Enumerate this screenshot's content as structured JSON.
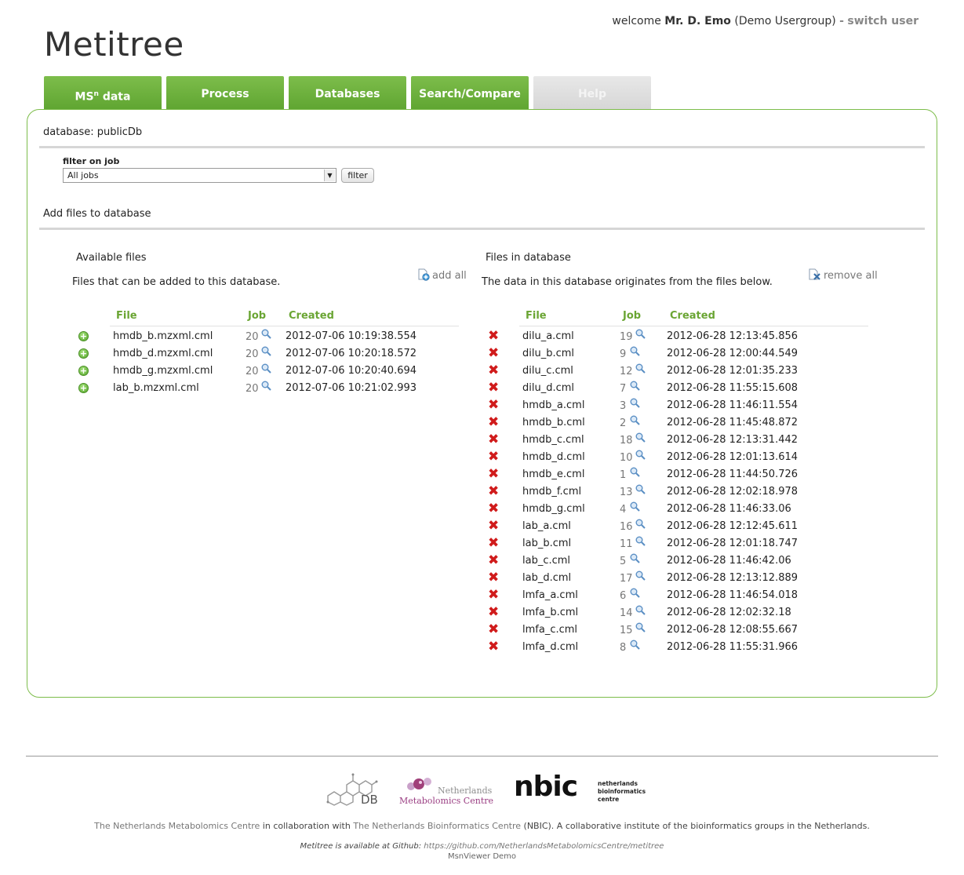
{
  "header": {
    "welcome_prefix": "welcome",
    "user_name": "Mr. D. Emo",
    "user_group": "(Demo Usergroup)",
    "separator": "-",
    "switch_user": "switch user"
  },
  "app_title": "Metitree",
  "tabs": [
    {
      "label": "MS",
      "sup": "n",
      "suffix": " data",
      "enabled": true
    },
    {
      "label": "Process",
      "enabled": true
    },
    {
      "label": "Databases",
      "enabled": true
    },
    {
      "label": "Search/Compare",
      "enabled": true
    },
    {
      "label": "Help",
      "enabled": false
    }
  ],
  "database_label": "database: publicDb",
  "filter": {
    "label": "filter on job",
    "selected": "All jobs",
    "button": "filter"
  },
  "add_files_heading": "Add files to database",
  "available": {
    "title": "Available files",
    "description": "Files that can be added to this database.",
    "add_all": "add all",
    "headers": [
      "File",
      "Job",
      "Created"
    ],
    "rows": [
      {
        "file": "hmdb_b.mzxml.cml",
        "job": "20",
        "created": "2012-07-06 10:19:38.554"
      },
      {
        "file": "hmdb_d.mzxml.cml",
        "job": "20",
        "created": "2012-07-06 10:20:18.572"
      },
      {
        "file": "hmdb_g.mzxml.cml",
        "job": "20",
        "created": "2012-07-06 10:20:40.694"
      },
      {
        "file": "lab_b.mzxml.cml",
        "job": "20",
        "created": "2012-07-06 10:21:02.993"
      }
    ]
  },
  "in_database": {
    "title": "Files in database",
    "description": "The data in this database originates from the files below.",
    "remove_all": "remove all",
    "headers": [
      "File",
      "Job",
      "Created"
    ],
    "rows": [
      {
        "file": "dilu_a.cml",
        "job": "19",
        "created": "2012-06-28 12:13:45.856"
      },
      {
        "file": "dilu_b.cml",
        "job": "9",
        "created": "2012-06-28 12:00:44.549"
      },
      {
        "file": "dilu_c.cml",
        "job": "12",
        "created": "2012-06-28 12:01:35.233"
      },
      {
        "file": "dilu_d.cml",
        "job": "7",
        "created": "2012-06-28 11:55:15.608"
      },
      {
        "file": "hmdb_a.cml",
        "job": "3",
        "created": "2012-06-28 11:46:11.554"
      },
      {
        "file": "hmdb_b.cml",
        "job": "2",
        "created": "2012-06-28 11:45:48.872"
      },
      {
        "file": "hmdb_c.cml",
        "job": "18",
        "created": "2012-06-28 12:13:31.442"
      },
      {
        "file": "hmdb_d.cml",
        "job": "10",
        "created": "2012-06-28 12:01:13.614"
      },
      {
        "file": "hmdb_e.cml",
        "job": "1",
        "created": "2012-06-28 11:44:50.726"
      },
      {
        "file": "hmdb_f.cml",
        "job": "13",
        "created": "2012-06-28 12:02:18.978"
      },
      {
        "file": "hmdb_g.cml",
        "job": "4",
        "created": "2012-06-28 11:46:33.06"
      },
      {
        "file": "lab_a.cml",
        "job": "16",
        "created": "2012-06-28 12:12:45.611"
      },
      {
        "file": "lab_b.cml",
        "job": "11",
        "created": "2012-06-28 12:01:18.747"
      },
      {
        "file": "lab_c.cml",
        "job": "5",
        "created": "2012-06-28 11:46:42.06"
      },
      {
        "file": "lab_d.cml",
        "job": "17",
        "created": "2012-06-28 12:13:12.889"
      },
      {
        "file": "lmfa_a.cml",
        "job": "6",
        "created": "2012-06-28 11:46:54.018"
      },
      {
        "file": "lmfa_b.cml",
        "job": "14",
        "created": "2012-06-28 12:02:32.18"
      },
      {
        "file": "lmfa_c.cml",
        "job": "15",
        "created": "2012-06-28 12:08:55.667"
      },
      {
        "file": "lmfa_d.cml",
        "job": "8",
        "created": "2012-06-28 11:55:31.966"
      }
    ]
  },
  "footer": {
    "logo_db_text": "DB",
    "logo_nmc_line1": "Netherlands",
    "logo_nmc_line2": "Metabolomics Centre",
    "logo_nbic_text": "nbic",
    "logo_nbic_sub1": "netherlands",
    "logo_nbic_sub2": "bioinformatics",
    "logo_nbic_sub3": "centre",
    "credits_link1": "The Netherlands Metabolomics Centre",
    "credits_mid": " in collaboration with ",
    "credits_link2": "The Netherlands Bioinformatics Centre",
    "credits_end": " (NBIC). A collaborative institute of the bioinformatics groups in the Netherlands.",
    "github_prefix": "Metitree is available at Github: ",
    "github_url": "https://github.com/NetherlandsMetabolomicsCentre/metitree",
    "demo_label": "MsnViewer Demo"
  },
  "colors": {
    "accent_green": "#6aa533",
    "tab_green": "#6cb13d",
    "delete_red": "#d01b1b",
    "panel_border": "#7dbd4b"
  }
}
